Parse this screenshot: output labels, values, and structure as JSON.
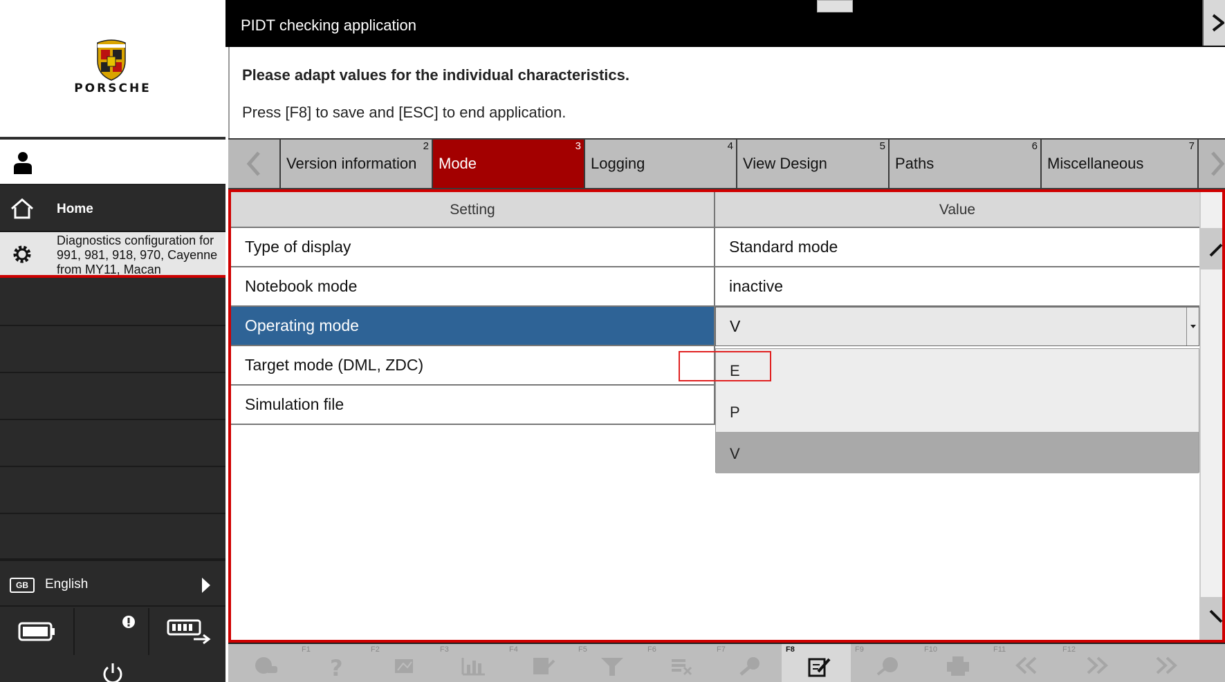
{
  "app": {
    "window_title": "PIDT checking application",
    "brand": "PORSCHE"
  },
  "sidebar": {
    "home_label": "Home",
    "diagnostics_label": "Diagnostics configuration for 991, 981, 918, 970, Cayenne from MY11, Macan",
    "language_code": "GB",
    "language_label": "English"
  },
  "instructions": {
    "headline": "Please adapt values for the individual characteristics.",
    "hint": "Press [F8] to save and [ESC] to end application."
  },
  "tabs": [
    {
      "label": "Version information",
      "number": "2",
      "active": false
    },
    {
      "label": "Mode",
      "number": "3",
      "active": true
    },
    {
      "label": "Logging",
      "number": "4",
      "active": false
    },
    {
      "label": "View Design",
      "number": "5",
      "active": false
    },
    {
      "label": "Paths",
      "number": "6",
      "active": false
    },
    {
      "label": "Miscellaneous",
      "number": "7",
      "active": false
    }
  ],
  "grid": {
    "header_setting": "Setting",
    "header_value": "Value",
    "rows": [
      {
        "setting": "Type of display",
        "value": "Standard mode"
      },
      {
        "setting": "Notebook mode",
        "value": "inactive"
      },
      {
        "setting": "Operating mode",
        "value": "V"
      },
      {
        "setting": "Target mode (DML, ZDC)",
        "value": ""
      },
      {
        "setting": "Simulation file",
        "value": ""
      }
    ],
    "selected_row": "Operating mode",
    "dropdown_options": [
      "E",
      "P",
      "V"
    ],
    "dropdown_highlighted": "V"
  },
  "function_keys": [
    "F1",
    "F2",
    "F3",
    "F4",
    "F5",
    "F6",
    "F7",
    "F8",
    "F9",
    "F10",
    "F11",
    "F12"
  ],
  "colors": {
    "accent_red": "#a30000",
    "selection_blue": "#2e6396",
    "highlight_frame": "#e02020"
  }
}
